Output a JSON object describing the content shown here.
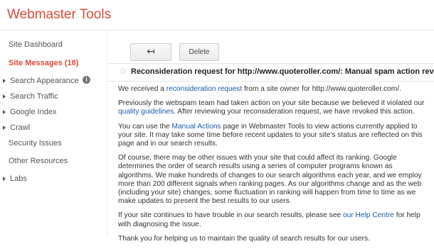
{
  "app": {
    "title": "Webmaster Tools"
  },
  "sidebar": {
    "items": [
      {
        "label": "Site Dashboard",
        "expandable": false,
        "active": false
      },
      {
        "label": "Site Messages (18)",
        "expandable": false,
        "active": true
      },
      {
        "label": "Search Appearance",
        "expandable": true,
        "active": false,
        "icon": "info-icon"
      },
      {
        "label": "Search Traffic",
        "expandable": true,
        "active": false
      },
      {
        "label": "Google Index",
        "expandable": true,
        "active": false
      },
      {
        "label": "Crawl",
        "expandable": true,
        "active": false
      },
      {
        "label": "Security Issues",
        "expandable": false,
        "active": false
      },
      {
        "label": "Other Resources",
        "expandable": false,
        "active": false
      },
      {
        "label": "Labs",
        "expandable": true,
        "active": false
      }
    ]
  },
  "toolbar": {
    "back_glyph": "↤",
    "delete_label": "Delete"
  },
  "message": {
    "star_glyph": "☆",
    "subject": "Reconsideration request for http://www.quoteroller.com/: Manual spam action revoked",
    "p1": {
      "a": "We received a ",
      "link": "reconsideration request",
      "b": " from a site owner for http://www.quoteroller.com/."
    },
    "p2": {
      "a": "Previously the webspam team had taken action on your site because we believed it violated our ",
      "link": "quality guidelines",
      "b": ". After reviewing your reconsideration request, we have revoked this action."
    },
    "p3": {
      "a": "You can use the ",
      "link": "Manual Actions",
      "b": " page in Webmaster Tools to view actions currently applied to your site. It may take some time before recent updates to your site's status are reflected on this page and in our search results."
    },
    "p4": "Of course, there may be other issues with your site that could affect its ranking. Google determines the order of search results using a series of computer programs known as algorithms. We make hundreds of changes to our search algorithms each year, and we employ more than 200 different signals when ranking pages. As our algorithms change and as the web (including your site) changes, some fluctuation in ranking will happen from time to time as we make updates to present the best results to our users.",
    "p5": {
      "a": "If your site continues to have trouble in our search results, please see ",
      "link": "our Help Centre",
      "b": " for help with diagnosing the issue."
    },
    "p6": "Thank you for helping us to maintain the quality of search results for our users."
  },
  "colors": {
    "brand": "#dd4b39",
    "link": "#1a5aa6"
  }
}
